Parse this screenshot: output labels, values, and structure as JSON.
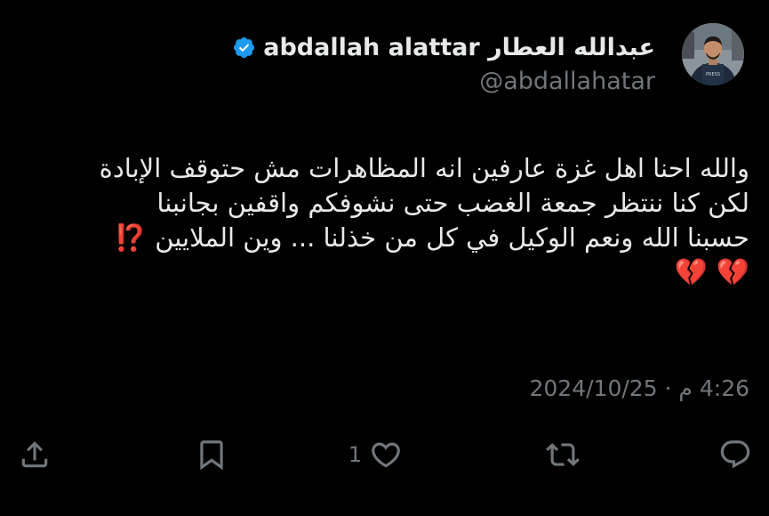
{
  "author": {
    "display_name": "عبدالله العطار abdallah alattar",
    "handle": "@abdallahatar",
    "verified": true,
    "avatar_icon": "avatar-photo",
    "verified_icon": "verified-badge-icon",
    "verified_color": "#1d9bf0"
  },
  "tweet": {
    "lines": [
      "والله احنا اهل غزة عارفين انه المظاهرات مش حتوقف الإبادة",
      "لكن كنا ننتظر جمعة الغضب حتى نشوفكم واقفين بجانبنا",
      "حسبنا الله ونعم الوكيل في كل من خذلنا ... وين الملايين"
    ],
    "emoji_interrobang": "⁉️",
    "emoji_hearts": "💔 💔"
  },
  "meta": {
    "timestamp": "4:26 م · 2024/10/25"
  },
  "actions": {
    "reply_icon": "reply-icon",
    "retweet_icon": "retweet-icon",
    "like_icon": "heart-icon",
    "like_count": "1",
    "bookmark_icon": "bookmark-icon",
    "share_icon": "share-icon"
  },
  "colors": {
    "background": "#000000",
    "text_primary": "#e7e9ea",
    "text_secondary": "#71767b",
    "accent": "#1d9bf0"
  }
}
